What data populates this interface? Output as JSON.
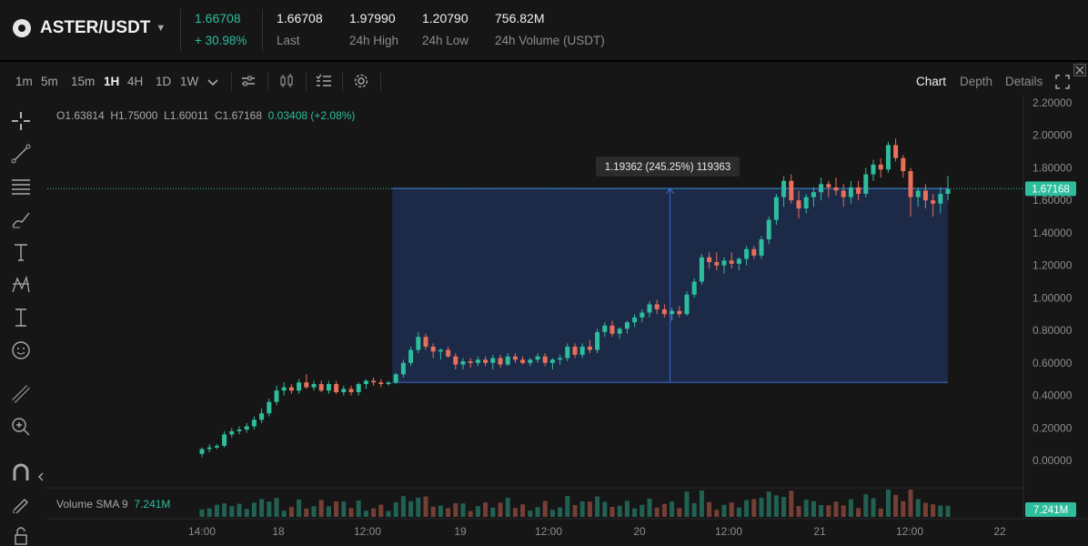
{
  "header": {
    "pair": "ASTER/USDT",
    "price": "1.66708",
    "change": "+ 30.98%",
    "stats": [
      {
        "value": "1.66708",
        "label": "Last"
      },
      {
        "value": "1.97990",
        "label": "24h High"
      },
      {
        "value": "1.20790",
        "label": "24h Low"
      },
      {
        "value": "756.82M",
        "label": "24h Volume (USDT)"
      }
    ]
  },
  "toolbar": {
    "timeframes": [
      "1m",
      "5m",
      "15m",
      "1H",
      "4H",
      "1D",
      "1W"
    ],
    "active_timeframe": "1H",
    "tabs": [
      "Chart",
      "Depth",
      "Details"
    ],
    "active_tab": "Chart"
  },
  "ohlc": {
    "o": "O1.63814",
    "h": "H1.75000",
    "l": "L1.60011",
    "c": "C1.67168",
    "chg": "0.03408 (+2.08%)"
  },
  "volume": {
    "label": "Volume SMA 9",
    "value": "7.241M",
    "badge": "7.241M"
  },
  "measure": {
    "label": "1.19362 (245.25%) 119363"
  },
  "colors": {
    "up": "#2ebd9d",
    "down": "#e8705a",
    "bg": "#161616",
    "measure": "#1c2a4a"
  },
  "chart_data": {
    "type": "candlestick",
    "y_ticks": [
      "2.20000",
      "2.00000",
      "1.80000",
      "1.60000",
      "1.40000",
      "1.20000",
      "1.00000",
      "0.80000",
      "0.60000",
      "0.40000",
      "0.20000",
      "0.00000"
    ],
    "ylim": [
      0,
      2.2
    ],
    "x_ticks": [
      "14:00",
      "18",
      "12:00",
      "19",
      "12:00",
      "20",
      "12:00",
      "21",
      "12:00",
      "22"
    ],
    "last_price": "1.67168",
    "measure_range": {
      "from": 0.48,
      "to": 1.674
    },
    "candles": [
      [
        0.04,
        0.08,
        0.02,
        0.07
      ],
      [
        0.07,
        0.1,
        0.05,
        0.08
      ],
      [
        0.08,
        0.1,
        0.07,
        0.09
      ],
      [
        0.09,
        0.18,
        0.08,
        0.16
      ],
      [
        0.16,
        0.2,
        0.14,
        0.18
      ],
      [
        0.18,
        0.21,
        0.16,
        0.19
      ],
      [
        0.19,
        0.23,
        0.17,
        0.21
      ],
      [
        0.21,
        0.27,
        0.19,
        0.25
      ],
      [
        0.25,
        0.32,
        0.23,
        0.29
      ],
      [
        0.29,
        0.38,
        0.27,
        0.36
      ],
      [
        0.36,
        0.46,
        0.34,
        0.43
      ],
      [
        0.43,
        0.48,
        0.4,
        0.45
      ],
      [
        0.45,
        0.47,
        0.41,
        0.43
      ],
      [
        0.43,
        0.5,
        0.41,
        0.48
      ],
      [
        0.48,
        0.53,
        0.44,
        0.45
      ],
      [
        0.45,
        0.49,
        0.43,
        0.47
      ],
      [
        0.47,
        0.49,
        0.42,
        0.43
      ],
      [
        0.43,
        0.49,
        0.41,
        0.47
      ],
      [
        0.47,
        0.49,
        0.41,
        0.42
      ],
      [
        0.42,
        0.46,
        0.4,
        0.44
      ],
      [
        0.44,
        0.46,
        0.4,
        0.42
      ],
      [
        0.42,
        0.48,
        0.4,
        0.47
      ],
      [
        0.47,
        0.5,
        0.44,
        0.49
      ],
      [
        0.49,
        0.51,
        0.46,
        0.48
      ],
      [
        0.48,
        0.5,
        0.45,
        0.47
      ],
      [
        0.47,
        0.49,
        0.46,
        0.48
      ],
      [
        0.48,
        0.54,
        0.47,
        0.53
      ],
      [
        0.53,
        0.62,
        0.51,
        0.6
      ],
      [
        0.6,
        0.7,
        0.58,
        0.68
      ],
      [
        0.68,
        0.79,
        0.66,
        0.76
      ],
      [
        0.76,
        0.78,
        0.68,
        0.7
      ],
      [
        0.7,
        0.72,
        0.63,
        0.67
      ],
      [
        0.67,
        0.69,
        0.62,
        0.68
      ],
      [
        0.68,
        0.7,
        0.63,
        0.64
      ],
      [
        0.64,
        0.66,
        0.56,
        0.59
      ],
      [
        0.59,
        0.63,
        0.56,
        0.61
      ],
      [
        0.61,
        0.63,
        0.57,
        0.6
      ],
      [
        0.6,
        0.64,
        0.58,
        0.62
      ],
      [
        0.62,
        0.64,
        0.58,
        0.6
      ],
      [
        0.6,
        0.65,
        0.56,
        0.63
      ],
      [
        0.63,
        0.65,
        0.57,
        0.59
      ],
      [
        0.59,
        0.66,
        0.58,
        0.64
      ],
      [
        0.64,
        0.66,
        0.6,
        0.62
      ],
      [
        0.62,
        0.64,
        0.59,
        0.6
      ],
      [
        0.6,
        0.63,
        0.58,
        0.62
      ],
      [
        0.62,
        0.66,
        0.6,
        0.64
      ],
      [
        0.64,
        0.66,
        0.58,
        0.6
      ],
      [
        0.6,
        0.63,
        0.56,
        0.62
      ],
      [
        0.62,
        0.65,
        0.59,
        0.63
      ],
      [
        0.63,
        0.72,
        0.61,
        0.7
      ],
      [
        0.7,
        0.72,
        0.63,
        0.65
      ],
      [
        0.65,
        0.72,
        0.63,
        0.7
      ],
      [
        0.7,
        0.74,
        0.66,
        0.68
      ],
      [
        0.68,
        0.81,
        0.66,
        0.79
      ],
      [
        0.79,
        0.85,
        0.76,
        0.83
      ],
      [
        0.83,
        0.86,
        0.76,
        0.78
      ],
      [
        0.78,
        0.82,
        0.75,
        0.81
      ],
      [
        0.81,
        0.86,
        0.78,
        0.85
      ],
      [
        0.85,
        0.9,
        0.82,
        0.88
      ],
      [
        0.88,
        0.93,
        0.85,
        0.91
      ],
      [
        0.91,
        0.98,
        0.88,
        0.96
      ],
      [
        0.96,
        0.99,
        0.9,
        0.93
      ],
      [
        0.93,
        0.96,
        0.88,
        0.9
      ],
      [
        0.9,
        0.94,
        0.86,
        0.92
      ],
      [
        0.92,
        0.95,
        0.88,
        0.9
      ],
      [
        0.9,
        1.04,
        0.89,
        1.02
      ],
      [
        1.02,
        1.12,
        1.0,
        1.1
      ],
      [
        1.1,
        1.27,
        1.08,
        1.25
      ],
      [
        1.25,
        1.28,
        1.18,
        1.22
      ],
      [
        1.22,
        1.28,
        1.17,
        1.2
      ],
      [
        1.2,
        1.25,
        1.15,
        1.23
      ],
      [
        1.23,
        1.28,
        1.18,
        1.21
      ],
      [
        1.21,
        1.25,
        1.17,
        1.24
      ],
      [
        1.24,
        1.32,
        1.2,
        1.3
      ],
      [
        1.3,
        1.32,
        1.24,
        1.26
      ],
      [
        1.26,
        1.38,
        1.24,
        1.36
      ],
      [
        1.36,
        1.5,
        1.33,
        1.48
      ],
      [
        1.48,
        1.64,
        1.45,
        1.62
      ],
      [
        1.62,
        1.75,
        1.56,
        1.72
      ],
      [
        1.72,
        1.76,
        1.58,
        1.6
      ],
      [
        1.6,
        1.66,
        1.49,
        1.55
      ],
      [
        1.55,
        1.64,
        1.52,
        1.62
      ],
      [
        1.62,
        1.68,
        1.56,
        1.65
      ],
      [
        1.65,
        1.74,
        1.6,
        1.7
      ],
      [
        1.7,
        1.72,
        1.62,
        1.68
      ],
      [
        1.68,
        1.74,
        1.63,
        1.66
      ],
      [
        1.66,
        1.7,
        1.56,
        1.62
      ],
      [
        1.62,
        1.72,
        1.58,
        1.68
      ],
      [
        1.68,
        1.72,
        1.6,
        1.64
      ],
      [
        1.64,
        1.8,
        1.62,
        1.76
      ],
      [
        1.76,
        1.85,
        1.72,
        1.82
      ],
      [
        1.82,
        1.86,
        1.74,
        1.79
      ],
      [
        1.79,
        1.96,
        1.77,
        1.94
      ],
      [
        1.94,
        1.98,
        1.84,
        1.86
      ],
      [
        1.86,
        1.88,
        1.74,
        1.78
      ],
      [
        1.78,
        1.8,
        1.5,
        1.62
      ],
      [
        1.62,
        1.68,
        1.56,
        1.66
      ],
      [
        1.66,
        1.7,
        1.55,
        1.6
      ],
      [
        1.6,
        1.64,
        1.5,
        1.58
      ],
      [
        1.58,
        1.68,
        1.52,
        1.64
      ],
      [
        1.64,
        1.75,
        1.6,
        1.67
      ]
    ]
  }
}
